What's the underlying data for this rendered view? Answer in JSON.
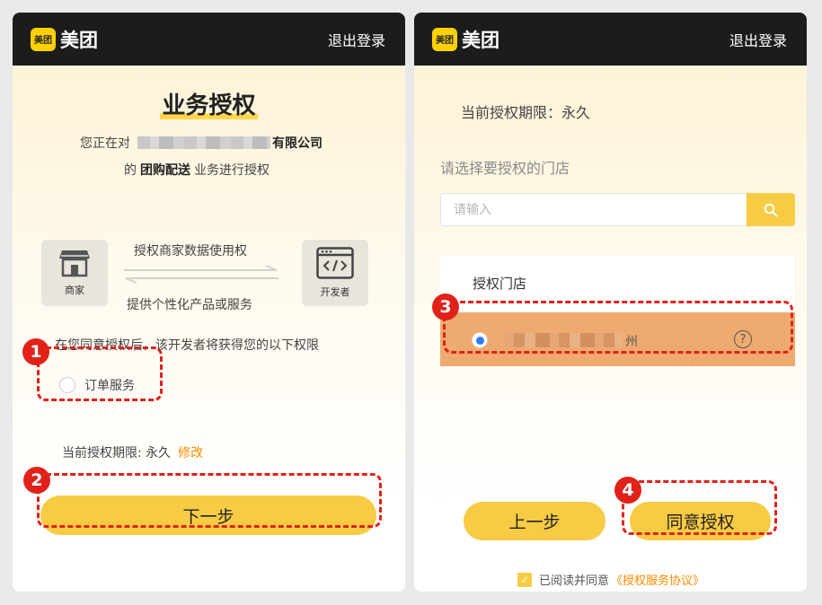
{
  "brand": {
    "badge_text": "美团",
    "name": "美团",
    "color": "#ffd100"
  },
  "header": {
    "logout_label": "退出登录"
  },
  "left": {
    "title": "业务授权",
    "intro_prefix": "您正在对",
    "company_suffix": "有限公司",
    "business_prefix": "的",
    "business_name": "团购配送",
    "business_suffix": "业务进行授权",
    "merchant_label": "商家",
    "developer_label": "开发者",
    "flow_top": "授权商家数据使用权",
    "flow_bottom": "提供个性化产品或服务",
    "permission_desc": "在您同意授权后，该开发者将获得您的以下权限",
    "permission_option": "订单服务",
    "period_label": "当前授权期限: 永久",
    "modify_link": "修改",
    "next_button": "下一步"
  },
  "right": {
    "period_label": "当前授权期限：永久",
    "select_prompt": "请选择要授权的门店",
    "search_placeholder": "请输入",
    "store_header": "授权门店",
    "store_name_visible": "州",
    "help_glyph": "?",
    "prev_button": "上一步",
    "agree_button": "同意授权",
    "agreement_text": "已阅读并同意",
    "agreement_link": "《授权服务协议》"
  },
  "annotations": {
    "step1": "1",
    "step2": "2",
    "step3": "3",
    "step4": "4",
    "color": "#e0221b"
  },
  "colors": {
    "accent": "#f7cb44",
    "link": "#ff8a00",
    "selected_row": "#efab6f",
    "radio_selected": "#2e7cf6"
  }
}
